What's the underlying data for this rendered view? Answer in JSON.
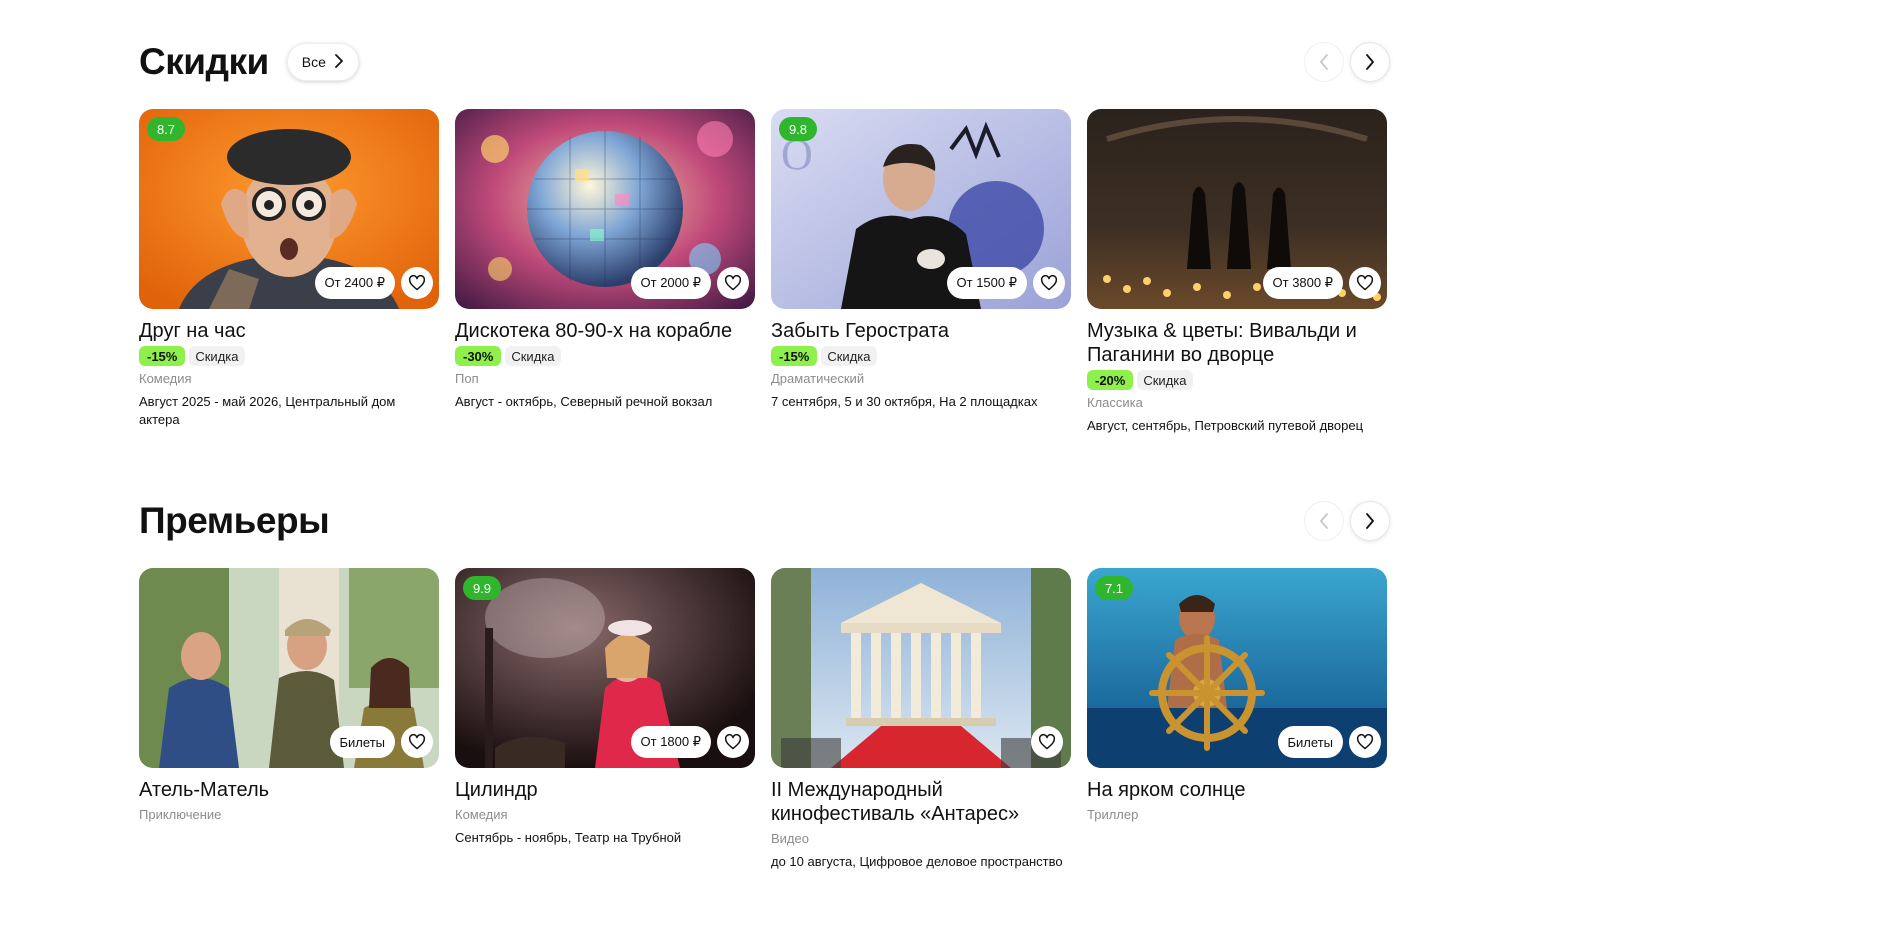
{
  "sections": [
    {
      "title": "Скидки",
      "all_label": "Все",
      "cards": [
        {
          "title": "Друг на час",
          "rating": "8.7",
          "price": "От 2400 ₽",
          "discount": "-15%",
          "discount_label": "Скидка",
          "genre": "Комедия",
          "venue": "Август 2025 - май 2026, Центральный дом актера"
        },
        {
          "title": "Дискотека 80-90-х на корабле",
          "rating": "",
          "price": "От 2000 ₽",
          "discount": "-30%",
          "discount_label": "Скидка",
          "genre": "Поп",
          "venue": "Август - октябрь, Северный речной вокзал"
        },
        {
          "title": "Забыть Герострата",
          "rating": "9.8",
          "price": "От 1500 ₽",
          "discount": "-15%",
          "discount_label": "Скидка",
          "genre": "Драматический",
          "venue": "7 сентября, 5 и 30 октября, На 2 площадках"
        },
        {
          "title": "Музыка & цветы: Вивальди и Паганини во дворце",
          "rating": "",
          "price": "От 3800 ₽",
          "discount": "-20%",
          "discount_label": "Скидка",
          "genre": "Классика",
          "venue": "Август, сентябрь, Петровский путевой дворец"
        }
      ]
    },
    {
      "title": "Премьеры",
      "cards": [
        {
          "title": "Атель-Матель",
          "rating": "",
          "price": "Билеты",
          "genre": "Приключение",
          "venue": ""
        },
        {
          "title": "Цилиндр",
          "rating": "9.9",
          "price": "От 1800 ₽",
          "genre": "Комедия",
          "venue": "Сентябрь - ноябрь, Театр на Трубной"
        },
        {
          "title": "II Международный кинофестиваль «Антарес»",
          "rating": "",
          "price": "",
          "genre": "Видео",
          "venue": "до 10 августа, Цифровое деловое пространство"
        },
        {
          "title": "На ярком солнце",
          "rating": "7.1",
          "price": "Билеты",
          "genre": "Триллер",
          "venue": ""
        }
      ]
    }
  ],
  "icons": {
    "favorite": "heart-icon",
    "prev": "chevron-left-icon",
    "next": "chevron-right-icon"
  },
  "colors": {
    "rating_badge": "#2fb62c",
    "discount_badge": "#8ef04a"
  }
}
